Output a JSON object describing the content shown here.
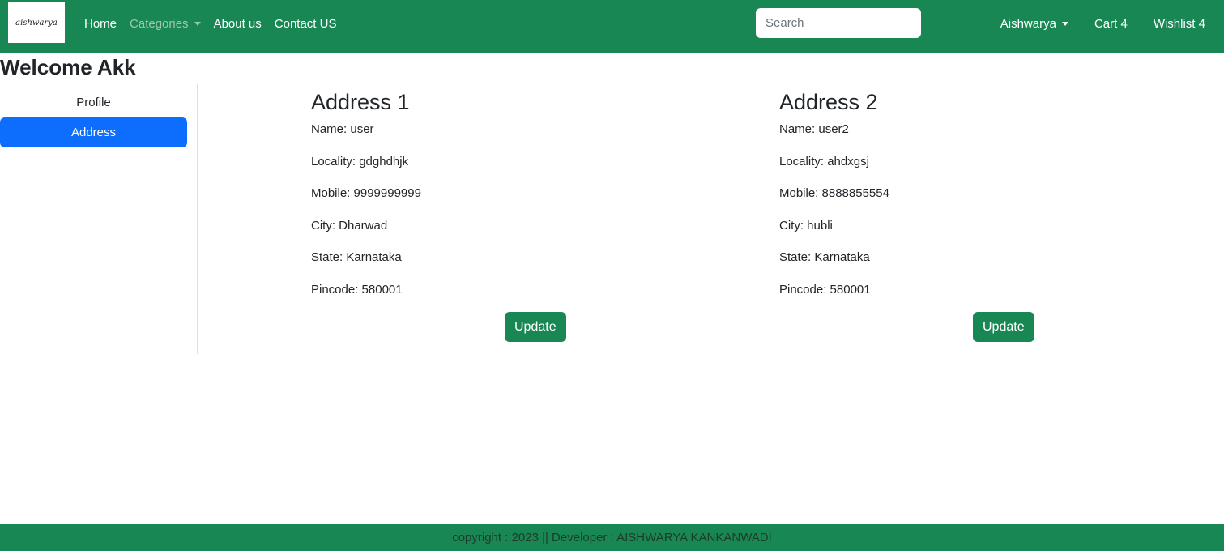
{
  "navbar": {
    "logo_text": "aishwarya",
    "links": {
      "home": "Home",
      "categories": "Categories",
      "about": "About us",
      "contact": "Contact US"
    },
    "search_placeholder": "Search",
    "user": "Aishwarya",
    "cart": "Cart 4",
    "wishlist": "Wishlist 4",
    "colors": {
      "brand": "#198754",
      "active": "#0d6efd"
    }
  },
  "page": {
    "welcome": "Welcome Akk"
  },
  "sidebar": {
    "items": [
      {
        "label": "Profile",
        "active": false
      },
      {
        "label": "Address",
        "active": true
      }
    ]
  },
  "addresses": [
    {
      "title": "Address 1",
      "name": "Name: user",
      "locality": "Locality: gdghdhjk",
      "mobile": "Mobile: 9999999999",
      "city": "City: Dharwad",
      "state": "State: Karnataka",
      "pincode": "Pincode: 580001",
      "button": "Update"
    },
    {
      "title": "Address 2",
      "name": "Name: user2",
      "locality": "Locality: ahdxgsj",
      "mobile": "Mobile: 8888855554",
      "city": "City: hubli",
      "state": "State: Karnataka",
      "pincode": "Pincode: 580001",
      "button": "Update"
    }
  ],
  "footer": {
    "text": "copyright : 2023 || Developer : AISHWARYA KANKANWADI"
  }
}
